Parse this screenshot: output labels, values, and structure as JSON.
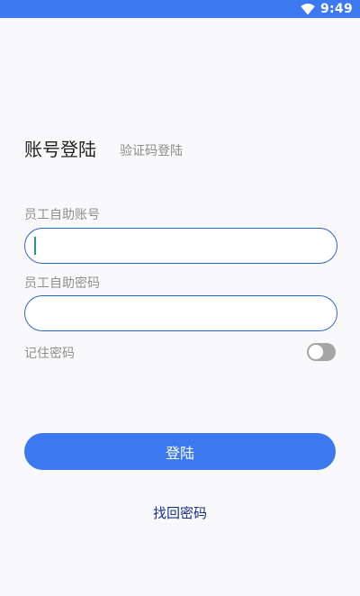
{
  "status_bar": {
    "time": "9:49",
    "icons": [
      "wifi-icon"
    ]
  },
  "tabs": {
    "account_login": "账号登陆",
    "code_login": "验证码登陆"
  },
  "form": {
    "account_label": "员工自助账号",
    "account_value": "",
    "password_label": "员工自助密码",
    "password_value": "",
    "remember_label": "记住密码",
    "remember_on": false
  },
  "actions": {
    "login_label": "登陆",
    "forgot_label": "找回密码"
  },
  "colors": {
    "accent": "#3c78ef",
    "input_border": "#2e66cf",
    "link": "#1a2f86",
    "toggle_off": "#a6a6a6"
  }
}
